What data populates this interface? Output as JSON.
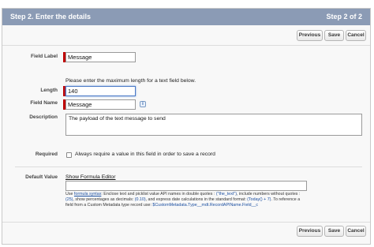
{
  "header": {
    "title": "Step 2. Enter the details",
    "step_indicator": "Step 2 of 2",
    "background_color": "#8b9bb5"
  },
  "buttons": {
    "previous": "Previous",
    "save": "Save",
    "cancel": "Cancel"
  },
  "fields": {
    "field_label": {
      "label": "Field Label",
      "value": "Message"
    },
    "length_hint": "Please enter the maximum length for a text field below.",
    "length": {
      "label": "Length",
      "value": "140"
    },
    "field_name": {
      "label": "Field Name",
      "value": "Message",
      "info_icon": "i"
    },
    "description": {
      "label": "Description",
      "value": "The payload of the text message to send"
    },
    "required": {
      "label": "Required",
      "checkbox_label": "Always require a value in this field in order to save a record",
      "checked": false
    },
    "default_value": {
      "label": "Default Value",
      "formula_link": "Show Formula Editor",
      "value": "",
      "help": {
        "use": "Use ",
        "formula_syntax": "formula syntax",
        "part1": ": Enclose text and picklist value API names in double quotes : ",
        "ex_text": "(\"the_text\")",
        "part2": ", include numbers without quotes : ",
        "ex_num": "(25)",
        "part3": ", show percentages as decimals: ",
        "ex_pct": "(0.10)",
        "part4": ", and express date calculations in the standard format: ",
        "ex_date": "(Today() + 7)",
        "part5": ". To reference a field from a Custom Metadata type record use: ",
        "ex_cmt": "$CustomMetadata.Type__mdt.RecordAPIName.Field__c"
      }
    }
  },
  "colors": {
    "required_bar": "#c00000",
    "link": "#1a4ea0",
    "focus_border": "#4a7ac7"
  }
}
